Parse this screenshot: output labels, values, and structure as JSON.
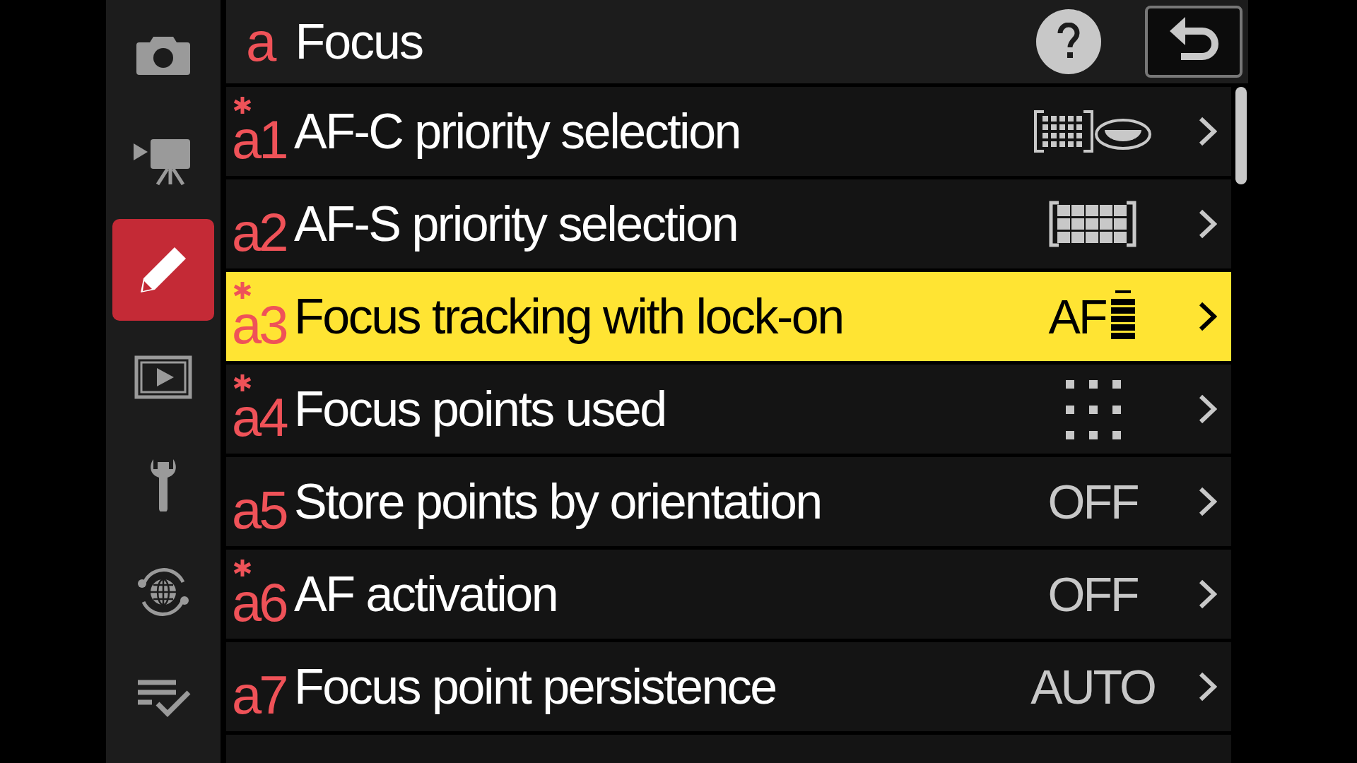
{
  "sidebar": {
    "items": [
      {
        "kind": "camera",
        "selected": false
      },
      {
        "kind": "movie",
        "selected": false
      },
      {
        "kind": "pencil",
        "selected": true
      },
      {
        "kind": "playback",
        "selected": false
      },
      {
        "kind": "wrench",
        "selected": false
      },
      {
        "kind": "network",
        "selected": false
      },
      {
        "kind": "checklist",
        "selected": false
      }
    ]
  },
  "header": {
    "letter": "a",
    "title": "Focus"
  },
  "rows": [
    {
      "code": "a1",
      "modified": true,
      "label": "AF-C priority selection",
      "selected": false,
      "value": {
        "kind": "release-focus"
      }
    },
    {
      "code": "a2",
      "modified": false,
      "label": "AF-S priority selection",
      "selected": false,
      "value": {
        "kind": "focus-grid"
      }
    },
    {
      "code": "a3",
      "modified": true,
      "label": "Focus tracking with lock-on",
      "selected": true,
      "value": {
        "kind": "af-bars",
        "text": "AF"
      }
    },
    {
      "code": "a4",
      "modified": true,
      "label": "Focus points used",
      "selected": false,
      "value": {
        "kind": "dot-grid"
      }
    },
    {
      "code": "a5",
      "modified": false,
      "label": "Store points by orientation",
      "selected": false,
      "value": {
        "kind": "text",
        "text": "OFF"
      }
    },
    {
      "code": "a6",
      "modified": true,
      "label": "AF activation",
      "selected": false,
      "value": {
        "kind": "text",
        "text": "OFF"
      }
    },
    {
      "code": "a7",
      "modified": false,
      "label": "Focus point persistence",
      "selected": false,
      "value": {
        "kind": "text",
        "text": "AUTO"
      }
    }
  ]
}
